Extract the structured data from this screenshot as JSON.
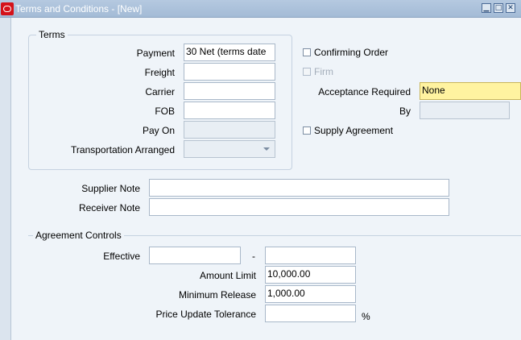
{
  "window": {
    "title": "Terms and Conditions - [New]"
  },
  "terms": {
    "group_title": "Terms",
    "payment_label": "Payment",
    "payment_value": "30 Net (terms date",
    "freight_label": "Freight",
    "freight_value": "",
    "carrier_label": "Carrier",
    "carrier_value": "",
    "fob_label": "FOB",
    "fob_value": "",
    "pay_on_label": "Pay On",
    "pay_on_value": "",
    "transport_label": "Transportation Arranged",
    "transport_value": ""
  },
  "options": {
    "confirming_order": "Confirming Order",
    "firm": "Firm",
    "acceptance_label": "Acceptance Required",
    "acceptance_value": "None",
    "by_label": "By",
    "by_value": "",
    "supply_agreement": "Supply Agreement"
  },
  "notes": {
    "supplier_label": "Supplier Note",
    "supplier_value": "",
    "receiver_label": "Receiver Note",
    "receiver_value": ""
  },
  "agreement": {
    "group_title": "Agreement Controls",
    "effective_label": "Effective",
    "effective_from": "",
    "dash": "-",
    "effective_to": "",
    "amount_limit_label": "Amount Limit",
    "amount_limit_value": "10,000.00",
    "min_release_label": "Minimum Release",
    "min_release_value": "1,000.00",
    "price_tol_label": "Price Update Tolerance",
    "price_tol_value": "",
    "percent": "%"
  }
}
